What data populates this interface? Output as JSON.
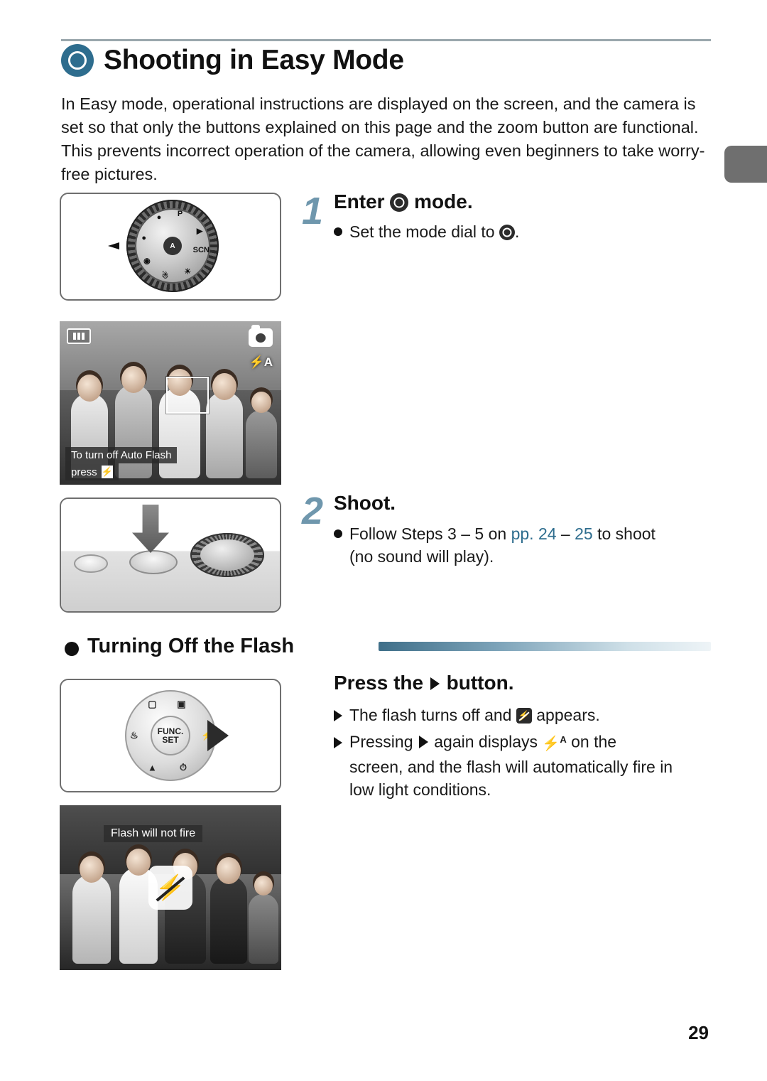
{
  "page": {
    "number": "29"
  },
  "header": {
    "title": "Shooting in Easy Mode",
    "badge_icon": "easy-mode-icon"
  },
  "intro": {
    "text": "In Easy mode, operational instructions are displayed on the screen, and the camera is set so that only the buttons explained on this page and the zoom button are functional. This prevents incorrect operation of the camera, allowing even beginners to take worry-free pictures."
  },
  "steps": [
    {
      "number": "1",
      "heading_before": "Enter",
      "heading_after": "mode.",
      "bullets": [
        {
          "marker": "dot",
          "before": "Set the mode dial to",
          "after": "."
        }
      ]
    },
    {
      "number": "2",
      "heading": "Shoot.",
      "bullets": [
        {
          "marker": "dot",
          "part1": "Follow Steps 3 – 5 on ",
          "link1": "pp. 24",
          "dash": " – ",
          "link2": "25",
          "part2": " to shoot",
          "line2": "(no sound will play)."
        }
      ]
    }
  ],
  "section": {
    "title": "Turning Off the Flash",
    "heading_before": "Press the",
    "heading_after": "button.",
    "bullets": [
      {
        "marker": "triangle",
        "before": "The flash turns off and",
        "after": "appears."
      },
      {
        "marker": "triangle",
        "before": "Pressing",
        "mid": "again displays",
        "after": "on the",
        "line2": "screen, and the flash will automatically fire in",
        "line3": "low light conditions."
      }
    ]
  },
  "figures": {
    "mode_dial": {
      "name": "mode-dial-illustration",
      "labels": [
        "P",
        "AUTO",
        "SCN",
        "AUTO"
      ]
    },
    "screen_easy": {
      "name": "easy-mode-screen",
      "hint_line1": "To turn off Auto Flash",
      "hint_line2": "press",
      "flash_indicator": "A"
    },
    "shutter": {
      "name": "shutter-button-illustration"
    },
    "controller": {
      "name": "four-way-controller-illustration",
      "center_label_top": "FUNC.",
      "center_label_bottom": "SET"
    },
    "screen_flash_off": {
      "name": "flash-off-screen",
      "label": "Flash will not fire"
    }
  }
}
